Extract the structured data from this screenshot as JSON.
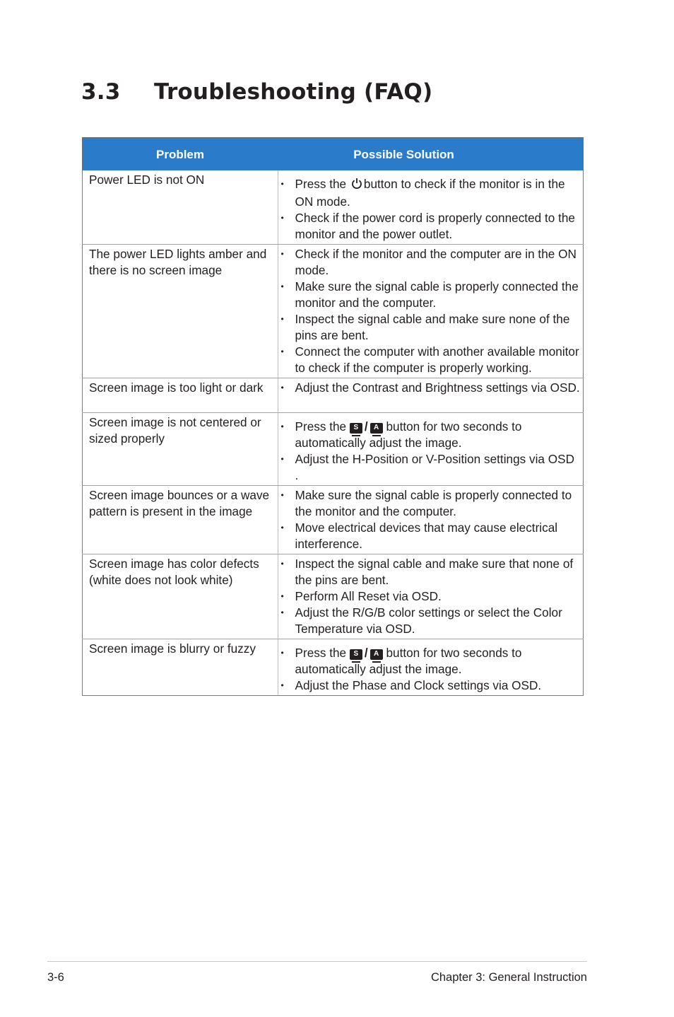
{
  "page": {
    "section_number": "3.3",
    "section_title": "Troubleshooting (FAQ)"
  },
  "table": {
    "headers": {
      "problem": "Problem",
      "solution": "Possible Solution"
    },
    "header_color": "#2a7bca",
    "rows": [
      {
        "problem": "Power  LED is not ON",
        "solutions": [
          {
            "pre": "Press the",
            "icon": "power-icon",
            "post": "button to check if the monitor is in the ON mode."
          },
          {
            "text": "Check if the power cord is properly connected to the monitor and the power outlet."
          }
        ]
      },
      {
        "problem": "The power LED lights amber and there is no screen image",
        "solutions": [
          {
            "text": "Check if the monitor and the computer are in the ON mode."
          },
          {
            "text": "Make sure the signal cable is properly connected the monitor and the computer."
          },
          {
            "text": "Inspect the signal cable and make sure none of the pins are bent."
          },
          {
            "text": "Connect the computer with another available monitor to check if the computer is properly working."
          }
        ]
      },
      {
        "problem": "Screen image is too light or dark",
        "solutions": [
          {
            "text": "Adjust the Contrast and Brightness settings via OSD."
          }
        ]
      },
      {
        "problem": "Screen image is not centered or sized properly",
        "solutions": [
          {
            "pre": "Press the",
            "keys": [
              "S",
              "A"
            ],
            "post": "button for two seconds to automatically adjust the image."
          },
          {
            "text": "Adjust the H-Position or V-Position settings via OSD ."
          }
        ]
      },
      {
        "problem": "Screen image bounces or a wave pattern is present in the image",
        "solutions": [
          {
            "text": "Make sure the signal cable is properly connected to the monitor and the computer."
          },
          {
            "text": "Move electrical devices that may cause electrical interference."
          }
        ]
      },
      {
        "problem": "Screen image has color defects (white does not look white)",
        "solutions": [
          {
            "text": "Inspect the signal cable and make sure that none of the pins are bent."
          },
          {
            "text": "Perform All Reset via OSD."
          },
          {
            "text": "Adjust the R/G/B color settings or select the Color Temperature via OSD."
          }
        ]
      },
      {
        "problem": "Screen image is blurry or fuzzy",
        "solutions": [
          {
            "pre": "Press the",
            "keys": [
              "S",
              "A"
            ],
            "post": "button for two seconds to automatically adjust the image."
          },
          {
            "text": "Adjust the Phase and Clock settings via OSD."
          }
        ]
      }
    ]
  },
  "footer": {
    "page_number": "3-6",
    "chapter": "Chapter 3: General Instruction"
  }
}
